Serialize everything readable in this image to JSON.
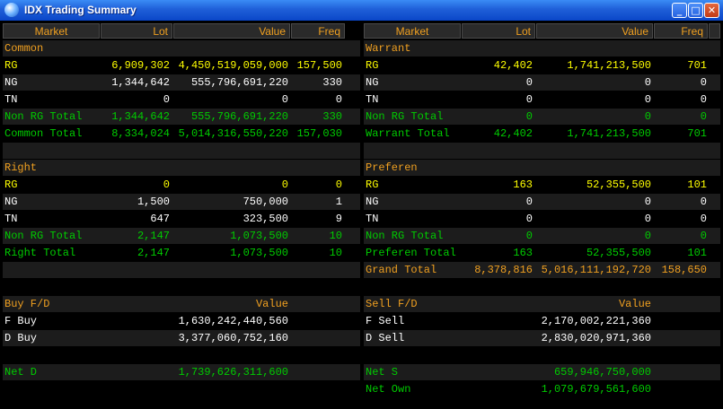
{
  "window": {
    "title": "IDX Trading Summary"
  },
  "headers": {
    "market": "Market",
    "lot": "Lot",
    "value": "Value",
    "freq": "Freq"
  },
  "left": {
    "common": {
      "title": "Common",
      "rows": [
        {
          "label": "RG",
          "lot": "6,909,302",
          "value": "4,450,519,059,000",
          "freq": "157,500"
        },
        {
          "label": "NG",
          "lot": "1,344,642",
          "value": "555,796,691,220",
          "freq": "330"
        },
        {
          "label": "TN",
          "lot": "0",
          "value": "0",
          "freq": "0"
        },
        {
          "label": "Non RG Total",
          "lot": "1,344,642",
          "value": "555,796,691,220",
          "freq": "330"
        },
        {
          "label": "Common Total",
          "lot": "8,334,024",
          "value": "5,014,316,550,220",
          "freq": "157,030"
        }
      ]
    },
    "right": {
      "title": "Right",
      "rows": [
        {
          "label": "RG",
          "lot": "0",
          "value": "0",
          "freq": "0"
        },
        {
          "label": "NG",
          "lot": "1,500",
          "value": "750,000",
          "freq": "1"
        },
        {
          "label": "TN",
          "lot": "647",
          "value": "323,500",
          "freq": "9"
        },
        {
          "label": "Non RG Total",
          "lot": "2,147",
          "value": "1,073,500",
          "freq": "10"
        },
        {
          "label": "Right Total",
          "lot": "2,147",
          "value": "1,073,500",
          "freq": "10"
        }
      ]
    },
    "buy": {
      "title": "Buy F/D",
      "value_header": "Value",
      "rows": [
        {
          "label": "F Buy",
          "value": "1,630,242,440,560"
        },
        {
          "label": "D Buy",
          "value": "3,377,060,752,160"
        }
      ],
      "net_label": "Net D",
      "net_value": "1,739,626,311,600"
    }
  },
  "right": {
    "warrant": {
      "title": "Warrant",
      "rows": [
        {
          "label": "RG",
          "lot": "42,402",
          "value": "1,741,213,500",
          "freq": "701"
        },
        {
          "label": "NG",
          "lot": "0",
          "value": "0",
          "freq": "0"
        },
        {
          "label": "TN",
          "lot": "0",
          "value": "0",
          "freq": "0"
        },
        {
          "label": "Non RG Total",
          "lot": "0",
          "value": "0",
          "freq": "0"
        },
        {
          "label": "Warrant Total",
          "lot": "42,402",
          "value": "1,741,213,500",
          "freq": "701"
        }
      ]
    },
    "preferen": {
      "title": "Preferen",
      "rows": [
        {
          "label": "RG",
          "lot": "163",
          "value": "52,355,500",
          "freq": "101"
        },
        {
          "label": "NG",
          "lot": "0",
          "value": "0",
          "freq": "0"
        },
        {
          "label": "TN",
          "lot": "0",
          "value": "0",
          "freq": "0"
        },
        {
          "label": "Non RG Total",
          "lot": "0",
          "value": "0",
          "freq": "0"
        },
        {
          "label": "Preferen Total",
          "lot": "163",
          "value": "52,355,500",
          "freq": "101"
        }
      ],
      "grand_label": "Grand Total",
      "grand_lot": "8,378,816",
      "grand_value": "5,016,111,192,720",
      "grand_freq": "158,650"
    },
    "sell": {
      "title": "Sell F/D",
      "value_header": "Value",
      "rows": [
        {
          "label": "F Sell",
          "value": "2,170,002,221,360"
        },
        {
          "label": "D Sell",
          "value": "2,830,020,971,360"
        }
      ],
      "net_label": "Net S",
      "net_value": "659,946,750,000",
      "net2_label": "Net Own",
      "net2_value": "1,079,679,561,600"
    }
  }
}
